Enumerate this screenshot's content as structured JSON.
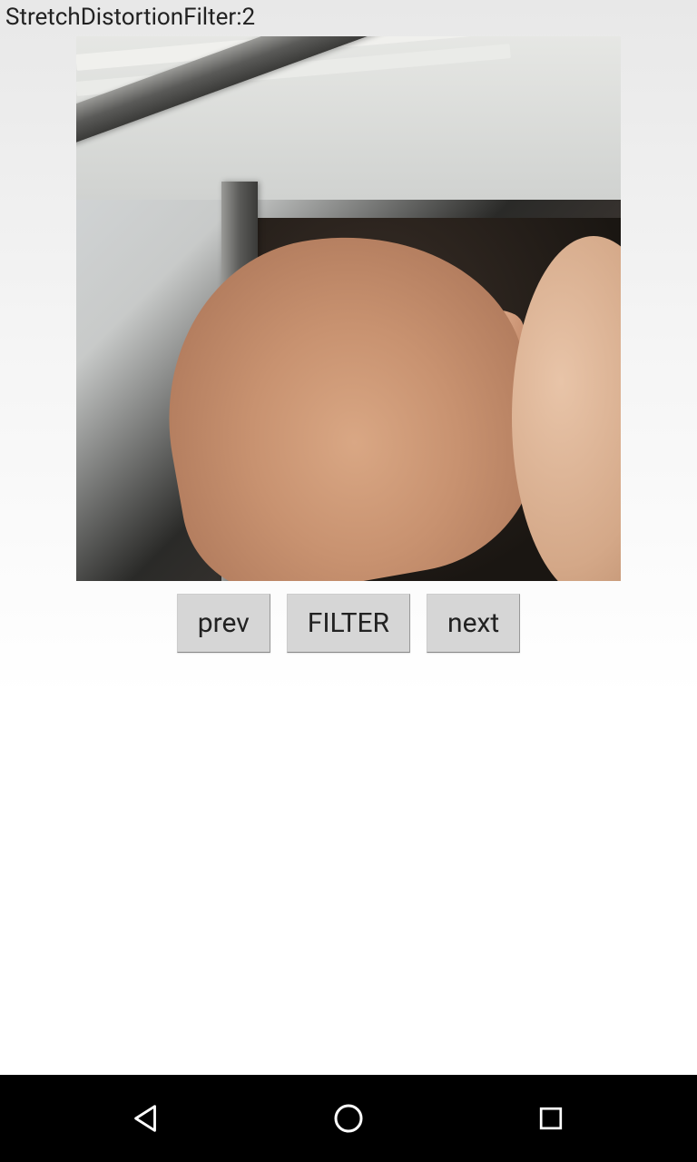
{
  "title": "StretchDistortionFilter:2",
  "buttons": {
    "prev": "prev",
    "filter": "FILTER",
    "next": "next"
  },
  "nav": {
    "back": "back-icon",
    "home": "home-icon",
    "recent": "recent-icon"
  }
}
